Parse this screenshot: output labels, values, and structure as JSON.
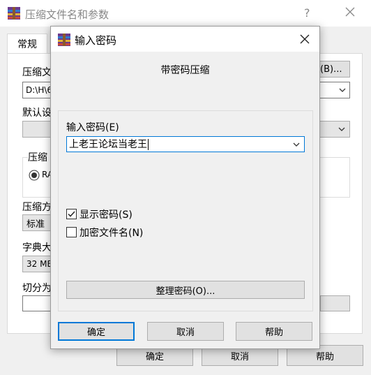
{
  "background_window": {
    "title": "压缩文件名和参数",
    "tabs": [
      {
        "label": "常规"
      }
    ],
    "labels": {
      "archive_name": "压缩文",
      "default_settings": "默认设",
      "archive_format": "压缩",
      "format_rar": "RA",
      "compression_method": "压缩方",
      "dictionary_size": "字典大",
      "split_volumes": "切分为"
    },
    "browse_button": "(B)...",
    "archive_path": "D:\\H\\6",
    "method_value": "标准",
    "dictionary_value": "32 MB",
    "side_paren": ")",
    "buttons": {
      "ok": "确定",
      "cancel": "取消",
      "help": "帮助"
    }
  },
  "dialog": {
    "title": "输入密码",
    "heading": "带密码压缩",
    "password_label": "输入密码(E)",
    "password_value": "上老王论坛当老王",
    "show_password": {
      "label": "显示密码(S)",
      "checked": true
    },
    "encrypt_filenames": {
      "label": "加密文件名(N)",
      "checked": false
    },
    "organize_button": "整理密码(O)...",
    "buttons": {
      "ok": "确定",
      "cancel": "取消",
      "help": "帮助"
    }
  },
  "colors": {
    "accent": "#0078d7",
    "window_bg": "#f0f0f0"
  },
  "icons": [
    "winrar-icon",
    "help-icon",
    "close-icon",
    "chevron-down-icon",
    "checkmark-icon",
    "radio-selected-icon"
  ]
}
